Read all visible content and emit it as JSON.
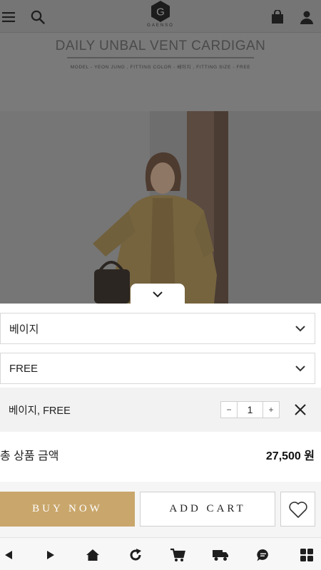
{
  "header": {
    "logo_letter": "G",
    "logo_text": "GAENSO",
    "icons": [
      "menu-icon",
      "search-icon",
      "shopping-bag-icon",
      "user-icon"
    ]
  },
  "product": {
    "title": "DAILY UNBAL VENT CARDIGAN",
    "subtitle": "MODEL - YEON JUNG , FITTING COLOR - 베이지 , FITTING SIZE - FREE"
  },
  "options": {
    "color_select": {
      "value": "베이지"
    },
    "size_select": {
      "value": "FREE"
    }
  },
  "selected_item": {
    "label": "베이지, FREE",
    "minus": "−",
    "quantity": "1",
    "plus": "+"
  },
  "total": {
    "label": "총 상품 금액",
    "value": "27,500 원"
  },
  "actions": {
    "buy_now": "BUY NOW",
    "add_cart": "ADD CART"
  },
  "bottom_nav": {
    "icons": [
      "back-icon",
      "forward-icon",
      "home-icon",
      "refresh-icon",
      "cart-icon",
      "delivery-truck-icon",
      "chat-icon",
      "grid-menu-icon"
    ]
  },
  "colors": {
    "buy_button": "#c9a66b",
    "overlay": "#757575",
    "selected_row_bg": "#f2f2f2"
  }
}
